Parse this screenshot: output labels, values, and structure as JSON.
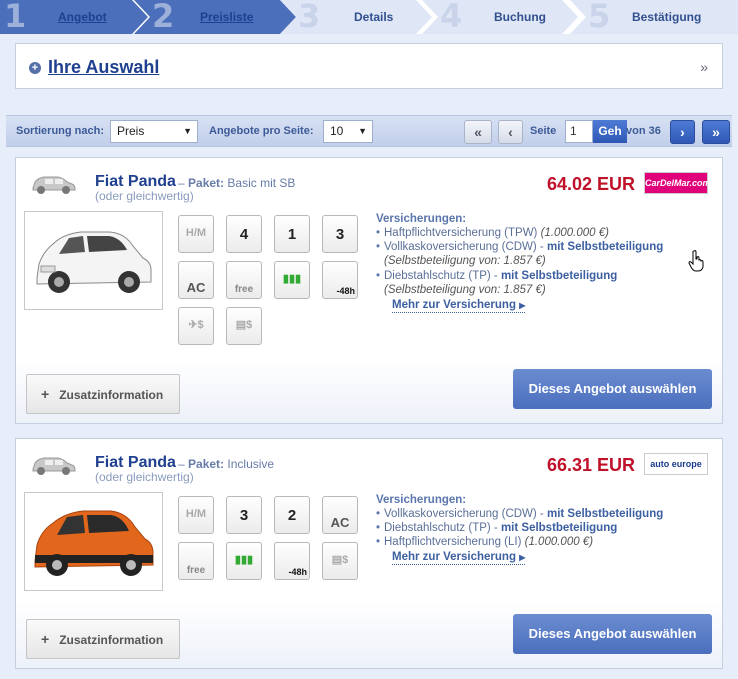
{
  "steps": [
    {
      "num": "1",
      "label": "Angebot",
      "active": true
    },
    {
      "num": "2",
      "label": "Preisliste",
      "active": true
    },
    {
      "num": "3",
      "label": "Details",
      "active": false
    },
    {
      "num": "4",
      "label": "Buchung",
      "active": false
    },
    {
      "num": "5",
      "label": "Bestätigung",
      "active": false
    }
  ],
  "selection": {
    "title": "Ihre Auswahl",
    "plus": "+",
    "chevron": "»"
  },
  "toolbar": {
    "sort_label": "Sortierung nach:",
    "sort_value": "Preis",
    "per_page_label": "Angebote pro Seite:",
    "per_page_value": "10",
    "first": "«",
    "prev": "‹",
    "next": "›",
    "last": "»",
    "page_label": "Seite",
    "page_value": "1",
    "go": "Geh",
    "of_label": "von 36"
  },
  "offers": [
    {
      "name": "Fiat Panda",
      "paket_label": "Paket:",
      "paket_sep": " – ",
      "paket": "Basic mit SB",
      "equiv": "(oder gleichwertig)",
      "price": "64.02 EUR",
      "logo": "CarDelMar.com",
      "features": [
        {
          "icon": "manual-gearbox-icon",
          "label": ""
        },
        {
          "icon": "seats-icon",
          "label": "4"
        },
        {
          "icon": "luggage-icon",
          "label": "1"
        },
        {
          "icon": "doors-icon",
          "label": "3"
        },
        {
          "icon": "air-conditioning-icon",
          "label": "AC"
        },
        {
          "icon": "free-km-icon",
          "label": "free"
        },
        {
          "icon": "fuel-icon",
          "label": ""
        },
        {
          "icon": "free-cancellation-icon",
          "label": "-48h"
        },
        {
          "icon": "airport-fee-icon",
          "label": ""
        },
        {
          "icon": "taxes-icon",
          "label": ""
        }
      ],
      "insurance": {
        "heading": "Versicherungen:",
        "items": [
          {
            "text": "Haftpflichtversicherung (TPW) ",
            "em": "(1.000.000 €)",
            "strong": ""
          },
          {
            "text": "Vollkaskoversicherung (CDW) - ",
            "em": "",
            "strong": "mit Selbstbeteiligung",
            "sub": "(Selbstbeteiligung von: 1.857 €)"
          },
          {
            "text": "Diebstahlschutz (TP) - ",
            "em": "",
            "strong": "mit Selbstbeteiligung",
            "sub": "(Selbstbeteiligung von: 1.857 €)"
          }
        ],
        "more": "Mehr zur Versicherung"
      },
      "extra": "Zusatzinformation",
      "choose": "Dieses Angebot auswählen"
    },
    {
      "name": "Fiat Panda",
      "paket_label": "Paket:",
      "paket_sep": " – ",
      "paket": "Inclusive",
      "equiv": "(oder gleichwertig)",
      "price": "66.31 EUR",
      "logo": "auto europe",
      "features": [
        {
          "icon": "manual-gearbox-icon",
          "label": ""
        },
        {
          "icon": "seats-icon",
          "label": "3"
        },
        {
          "icon": "luggage-icon",
          "label": "2"
        },
        {
          "icon": "air-conditioning-icon",
          "label": "AC"
        },
        {
          "icon": "free-km-icon",
          "label": "free"
        },
        {
          "icon": "fuel-icon",
          "label": ""
        },
        {
          "icon": "free-cancellation-icon",
          "label": "-48h"
        },
        {
          "icon": "taxes-icon",
          "label": ""
        }
      ],
      "insurance": {
        "heading": "Versicherungen:",
        "items": [
          {
            "text": "Vollkaskoversicherung (CDW) - ",
            "em": "",
            "strong": "mit Selbstbeteiligung"
          },
          {
            "text": "Diebstahlschutz (TP) - ",
            "em": "",
            "strong": "mit Selbstbeteiligung"
          },
          {
            "text": "Haftpflichtversicherung (LI) ",
            "em": "(1.000.000 €)",
            "strong": ""
          }
        ],
        "more": "Mehr zur Versicherung"
      },
      "extra": "Zusatzinformation",
      "choose": "Dieses Angebot auswählen"
    }
  ],
  "colors": {
    "accent": "#1f3f8f",
    "price": "#c0102a",
    "button": "#4c6fbe"
  }
}
